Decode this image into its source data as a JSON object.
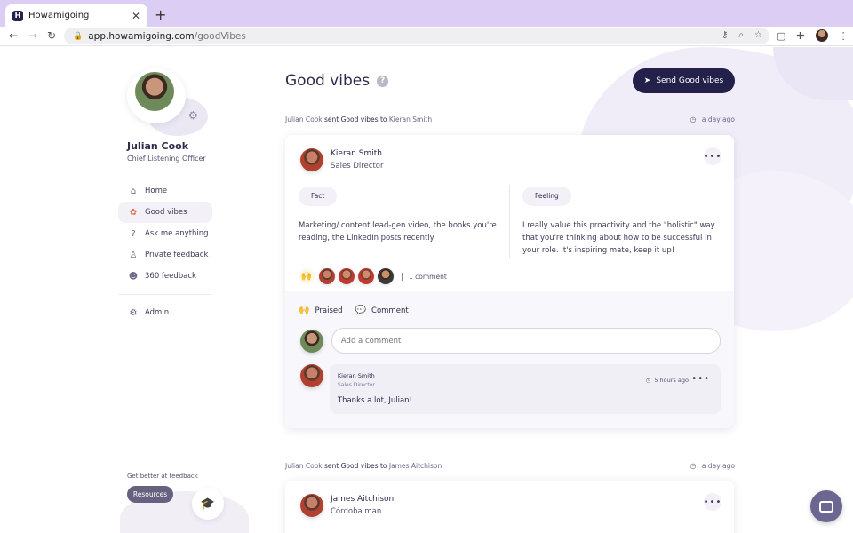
{
  "browser": {
    "tab_title": "Howamigoing",
    "tab_favicon": "H",
    "url_host": "app.howamigoing.com",
    "url_path": "/goodVibes"
  },
  "sidebar": {
    "user_name": "Julian Cook",
    "user_role": "Chief Listening Officer",
    "items": [
      {
        "label": "Home",
        "icon": "home-icon",
        "glyph": "⌂"
      },
      {
        "label": "Good vibes",
        "icon": "award-icon",
        "glyph": "✿"
      },
      {
        "label": "Ask me anything",
        "icon": "question-icon",
        "glyph": "?"
      },
      {
        "label": "Private feedback",
        "icon": "person-icon",
        "glyph": "♙"
      },
      {
        "label": "360 feedback",
        "icon": "group-icon",
        "glyph": "☻"
      }
    ],
    "admin_label": "Admin",
    "get_better": "Get better at feedback",
    "resources_label": "Resources"
  },
  "main": {
    "title": "Good vibes",
    "send_button": "Send Good vibes",
    "feed": [
      {
        "from": "Julian Cook",
        "verb": "sent Good vibes to",
        "to": "Kieran Smith",
        "time": "a day ago",
        "recipient_name": "Kieran Smith",
        "recipient_role": "Sales Director",
        "fact_label": "Fact",
        "fact_text": "Marketing/ content lead-gen video, the books you're reading, the LinkedIn posts recently",
        "feeling_label": "Feeling",
        "feeling_text": "I really value this proactivity and the \"holistic\" way that you're thinking about how to be successful in your role.  It's inspiring mate, keep it up!",
        "comment_count": "1 comment",
        "praised_label": "Praised",
        "comment_label": "Comment",
        "comment_placeholder": "Add a comment",
        "reply": {
          "name": "Kieran Smith",
          "role": "Sales Director",
          "time": "5 hours ago",
          "text": "Thanks a lot, Julian!"
        }
      },
      {
        "from": "Julian Cook",
        "verb": "sent Good vibes to",
        "to": "James Aitchison",
        "time": "a day ago",
        "recipient_name": "James Aitchison",
        "recipient_role": "Córdoba man"
      }
    ]
  }
}
